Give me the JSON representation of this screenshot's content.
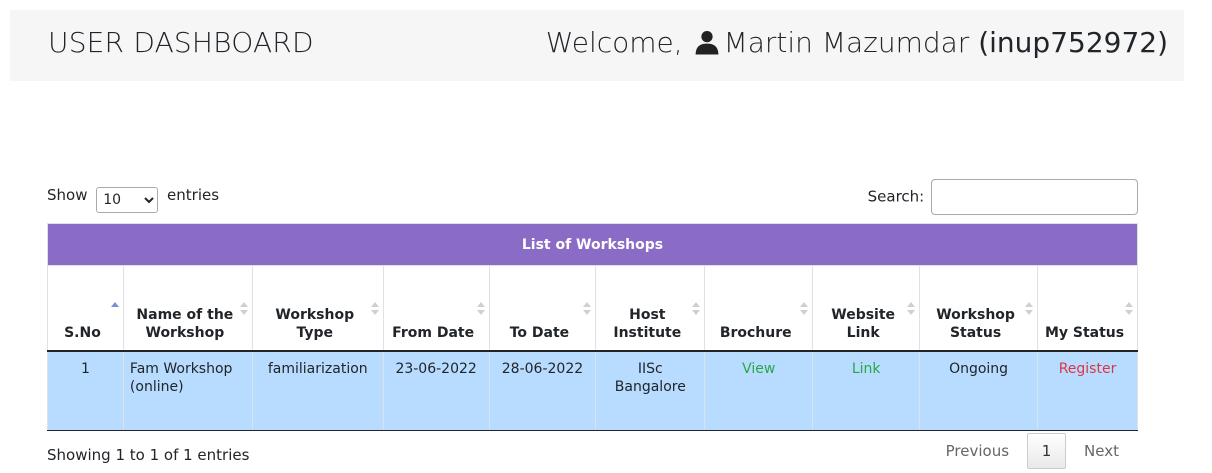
{
  "header": {
    "title": "USER DASHBOARD",
    "welcome_prefix": "Welcome,",
    "user_name": "Martin Mazumdar",
    "user_id": "(inup752972)",
    "user_icon": "user-icon"
  },
  "controls": {
    "show_label": "Show",
    "entries_label": "entries",
    "page_length": "10",
    "page_length_options": [
      "10"
    ],
    "search_label": "Search:",
    "search_value": ""
  },
  "table": {
    "caption": "List of Workshops",
    "columns": [
      "S.No",
      "Name of the Workshop",
      "Workshop Type",
      "From Date",
      "To Date",
      "Host Institute",
      "Brochure",
      "Website Link",
      "Workshop Status",
      "My Status"
    ],
    "rows": [
      {
        "sno": "1",
        "name": "Fam Workshop (online)",
        "type": "familiarization",
        "from": "23-06-2022",
        "to": "28-06-2022",
        "host": "IISc Bangalore",
        "brochure": "View",
        "website": "Link",
        "status": "Ongoing",
        "my_status": "Register"
      }
    ]
  },
  "footer": {
    "info": "Showing 1 to 1 of 1 entries",
    "previous": "Previous",
    "current_page": "1",
    "next": "Next"
  },
  "colors": {
    "caption_bg": "#8a6cc7",
    "row_bg": "#b8dcff",
    "link_green": "#28a745",
    "link_red": "#dc3545"
  }
}
